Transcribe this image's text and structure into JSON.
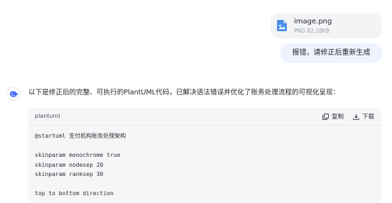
{
  "attachment": {
    "file_name": "image.png",
    "file_meta": "PNG 82.28KB",
    "icon": "image-file-icon"
  },
  "user_message": "报错，请修正后重新生成",
  "assistant": {
    "avatar_icon": "whale-logo-icon",
    "intro": "以下是修正后的完整、可执行的PlantUML代码，已解决语法错误并优化了账务处理流程的可视化呈现：",
    "code_block": {
      "language": "plantuml",
      "copy_label": "复制",
      "download_label": "下载",
      "lines": [
        "@startuml 支付机构账务处理架构",
        "",
        "skinparam monochrome true",
        "skinparam nodesep 20",
        "skinparam ranksep 30",
        "",
        "top to bottom direction"
      ]
    }
  }
}
